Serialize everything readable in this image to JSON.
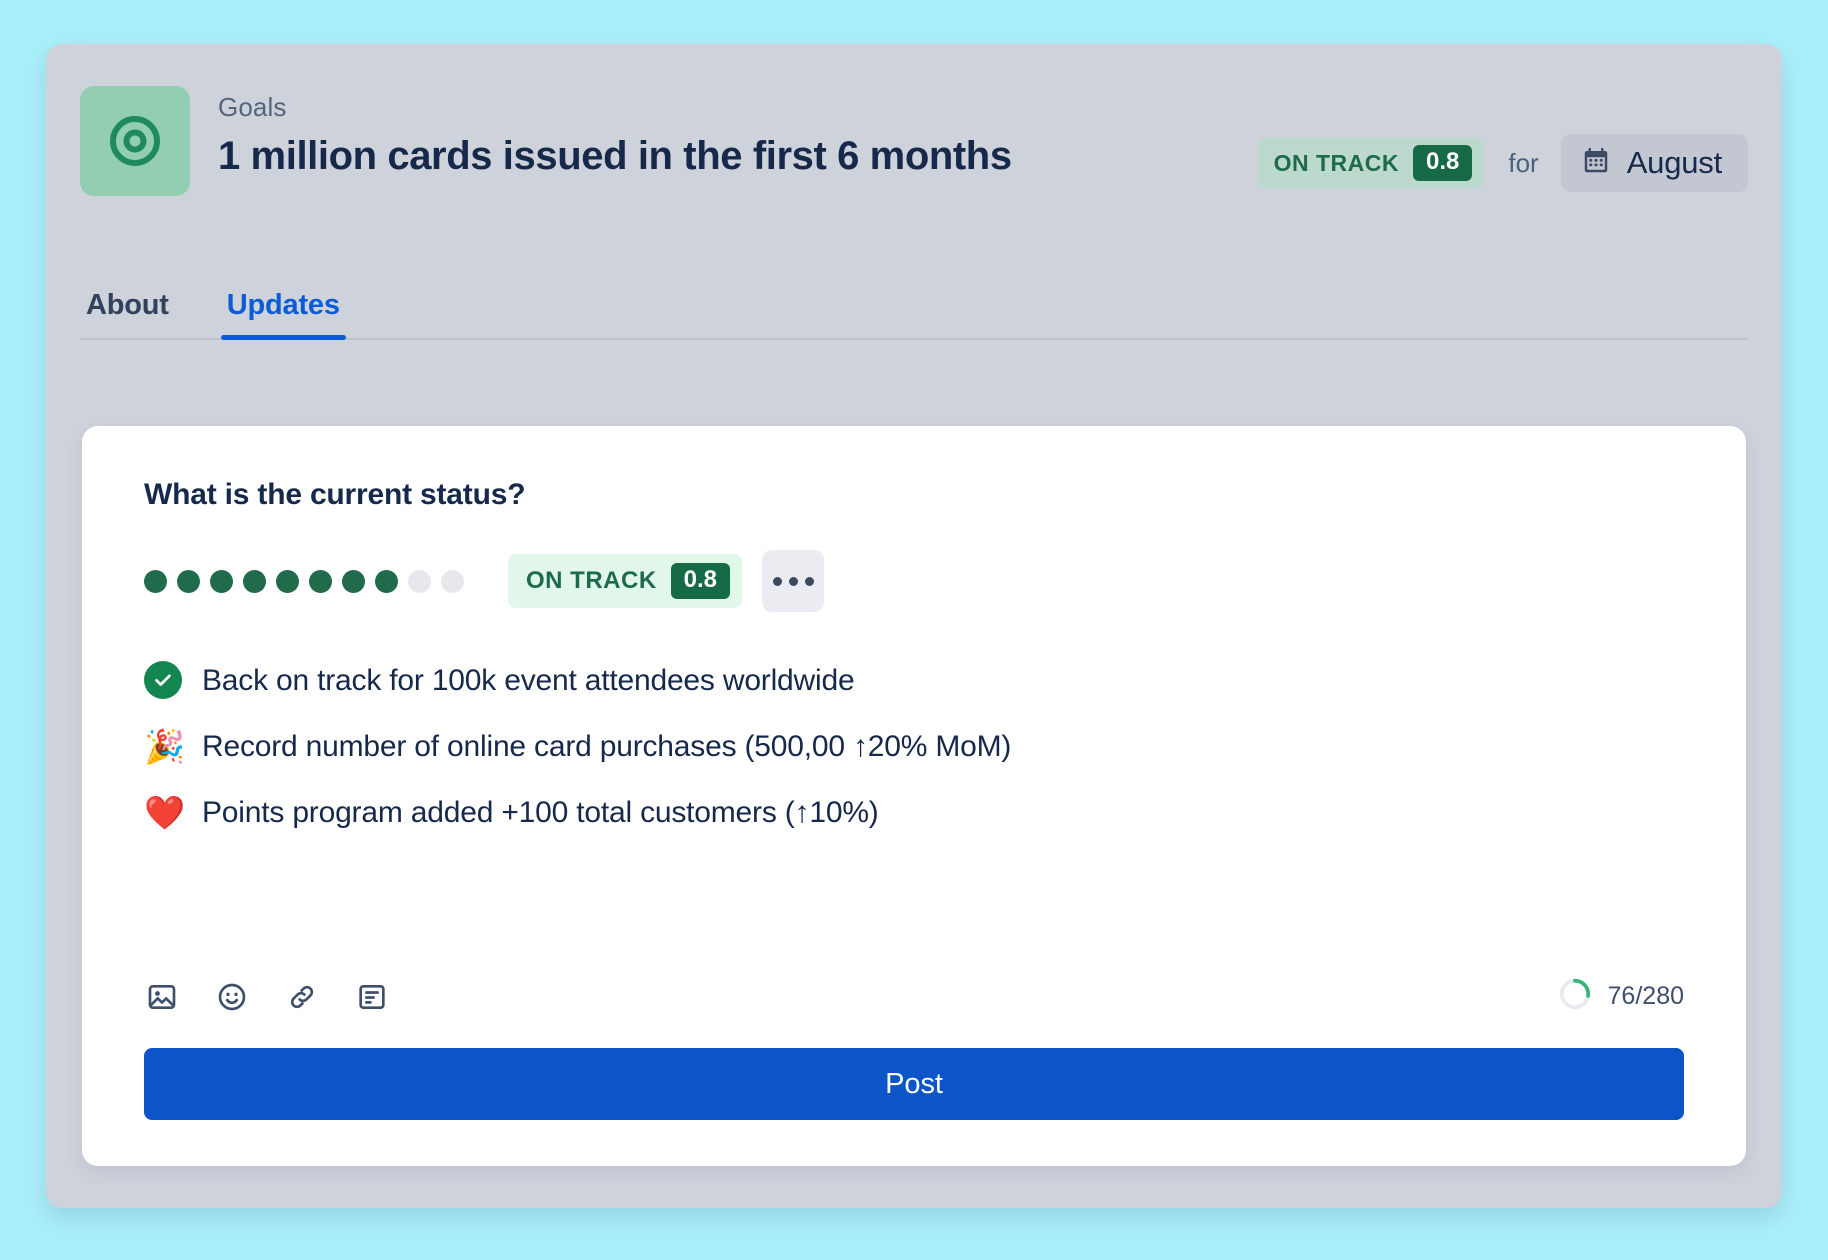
{
  "header": {
    "eyebrow": "Goals",
    "title": "1 million cards issued in the first 6 months",
    "goal_icon": "target-icon",
    "status": {
      "label": "ON TRACK",
      "score": "0.8"
    },
    "for_label": "for",
    "period": {
      "icon": "calendar-icon",
      "month": "August"
    }
  },
  "tabs": [
    {
      "label": "About",
      "active": false
    },
    {
      "label": "Updates",
      "active": true
    }
  ],
  "composer": {
    "title": "What is the current status?",
    "score_dots": {
      "total": 10,
      "filled": 8
    },
    "status": {
      "label": "ON TRACK",
      "score": "0.8"
    },
    "more_menu": "more-options-icon",
    "bullets": [
      {
        "emoji": "check-circle-icon",
        "text": "Back on track for 100k event attendees worldwide"
      },
      {
        "emoji": "🎉",
        "text": "Record number of online card purchases (500,00 ↑20% MoM)"
      },
      {
        "emoji": "❤️",
        "text": "Points program added +100 total customers (↑10%)"
      }
    ],
    "toolbar": [
      {
        "name": "image-icon",
        "label": "Insert image"
      },
      {
        "name": "emoji-icon",
        "label": "Insert emoji"
      },
      {
        "name": "link-icon",
        "label": "Insert link"
      },
      {
        "name": "note-icon",
        "label": "Insert note"
      }
    ],
    "counter": {
      "text": "76/280",
      "used": 76,
      "limit": 280
    },
    "post_label": "Post"
  },
  "colors": {
    "page_background": "#aaf0fb",
    "panel": "#ced2db",
    "card": "#ffffff",
    "accent_blue": "#0b55c8",
    "tab_active": "#0b5cd5",
    "status_green": "#166b46",
    "status_pill_header": "#bcd9cd",
    "status_pill_composer": "#e1f7ea",
    "goal_icon_background": "#93ceb3",
    "text_primary": "#17294a",
    "text_muted": "#54657e"
  }
}
